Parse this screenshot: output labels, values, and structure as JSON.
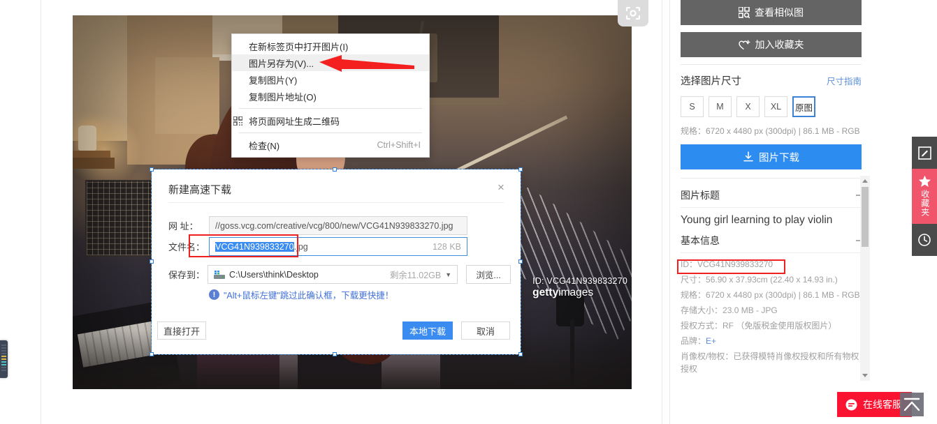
{
  "context_menu": {
    "items": [
      {
        "label": "在新标签页中打开图片(I)",
        "icon": "",
        "shortcut": "",
        "highlighted": false
      },
      {
        "label": "图片另存为(V)...",
        "icon": "",
        "shortcut": "",
        "highlighted": true
      },
      {
        "label": "复制图片(Y)",
        "icon": "",
        "shortcut": "",
        "highlighted": false
      },
      {
        "label": "复制图片地址(O)",
        "icon": "",
        "shortcut": "",
        "highlighted": false
      },
      {
        "label": "将页面网址生成二维码",
        "icon": "qrcode-icon",
        "shortcut": "",
        "highlighted": false
      },
      {
        "label": "检查(N)",
        "icon": "",
        "shortcut": "Ctrl+Shift+I",
        "highlighted": false
      }
    ]
  },
  "dialog": {
    "title": "新建高速下载",
    "close_icon": "×",
    "url_label": "网 址：",
    "url_value": "//goss.vcg.com/creative/vcg/800/new/VCG41N939833270.jpg",
    "filename_label": "文件名：",
    "filename_selected": "VCG41N939833270",
    "filename_ext": ".jpg",
    "filesize": "128 KB",
    "saveto_label": "保存到：",
    "saveto_value": "C:\\Users\\think\\Desktop",
    "free_space": "剩余11.02GB",
    "browse_label": "浏览...",
    "hint": "\"Alt+鼠标左键\"跳过此确认框，下载更快捷！",
    "open_label": "直接打开",
    "download_label": "本地下载",
    "cancel_label": "取消"
  },
  "photo": {
    "camera_icon": "camera-viewfinder-icon",
    "watermark_id": "ID: VCG41N939833270",
    "watermark_brand_bold": "getty",
    "watermark_brand_light": "images",
    "watermark_brand_tm": "’"
  },
  "sidebar": {
    "similar_button": "查看相似图",
    "similar_icon": "grid-search-icon",
    "favorite_button": "加入收藏夹",
    "favorite_icon": "heart-plus-icon",
    "size_section_title": "选择图片尺寸",
    "size_guide_link": "尺寸指南",
    "sizes": [
      {
        "label": "S",
        "active": false
      },
      {
        "label": "M",
        "active": false
      },
      {
        "label": "X",
        "active": false
      },
      {
        "label": "XL",
        "active": false
      },
      {
        "label": "原图",
        "active": true
      }
    ],
    "spec_line": "规格：6720 x 4480 px (300dpi) | 86.1 MB - RGB",
    "download_button": "图片下载",
    "download_icon": "download-icon",
    "title_block": {
      "heading": "图片标题",
      "collapse_icon": "−",
      "value": "Young girl learning to play violin"
    },
    "info_block": {
      "heading": "基本信息",
      "collapse_icon": "−",
      "rows": [
        {
          "key": "ID：",
          "value": "VCG41N939833270",
          "highlighted": true
        },
        {
          "key": "尺寸：",
          "value": "56.90 x 37.93cm (22.40 x 14.93 in.)",
          "highlighted": false
        },
        {
          "key": "规格：",
          "value": "6720 x 4480 px (300dpi) | 86.1 MB - RGB",
          "highlighted": false
        },
        {
          "key": "存储大小：",
          "value": "23.0 MB - JPG",
          "highlighted": false
        },
        {
          "key": "授权方式：",
          "value": "RF （免版税金使用版权图片）",
          "highlighted": false
        },
        {
          "key": "品牌：",
          "value": "E+",
          "highlighted": false,
          "link": true
        },
        {
          "key": "肖像权/物权：",
          "value": "已获得模特肖像权授权和所有物权授权",
          "highlighted": false
        }
      ]
    }
  },
  "rail": {
    "edit_icon": "edit-square-icon",
    "favorites_label": "收藏夹",
    "favorites_icon": "star-icon",
    "history_icon": "clock-icon"
  },
  "service": {
    "label": "在线客服",
    "icon": "chat-bubble-icon",
    "to_top_icon": "chevron-up-icon"
  },
  "colors": {
    "accent_blue": "#2d8cf0",
    "dialog_blue": "#3b8cf0",
    "selection_blue": "#3b8cf0",
    "favorites_red": "#f1556c",
    "service_red": "#fa1432",
    "highlight_red": "#f02020",
    "side_button_gray": "#646464"
  }
}
